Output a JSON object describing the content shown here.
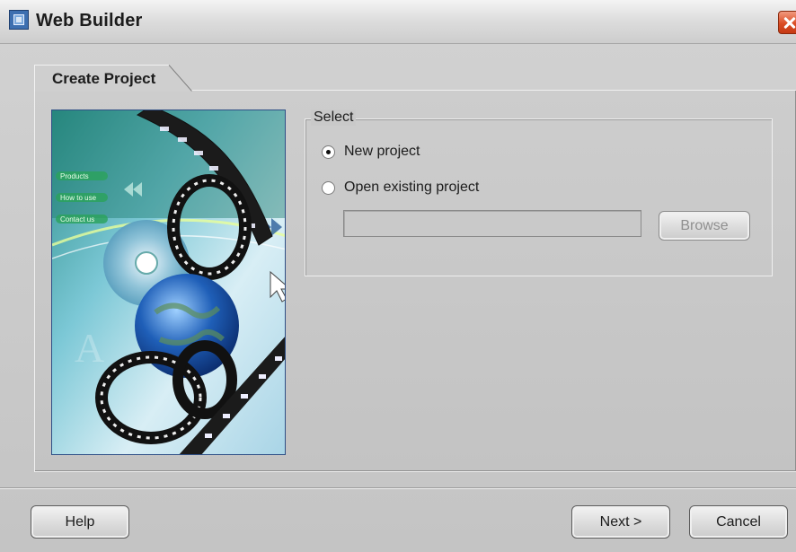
{
  "window": {
    "title": "Web Builder",
    "app_icon": "web-builder-icon",
    "close_icon": "close-icon"
  },
  "tab": {
    "label": "Create Project"
  },
  "group": {
    "legend": "Select",
    "options": [
      {
        "label": "New project",
        "checked": true
      },
      {
        "label": "Open existing project",
        "checked": false
      }
    ],
    "path_value": "",
    "browse_label": "Browse"
  },
  "art": {
    "menu_items": [
      "Products",
      "How to use",
      "Contact us"
    ]
  },
  "footer": {
    "help_label": "Help",
    "next_label": "Next >",
    "cancel_label": "Cancel"
  },
  "colors": {
    "accent_close": "#db4d25",
    "art_frame": "#2f4f86"
  }
}
